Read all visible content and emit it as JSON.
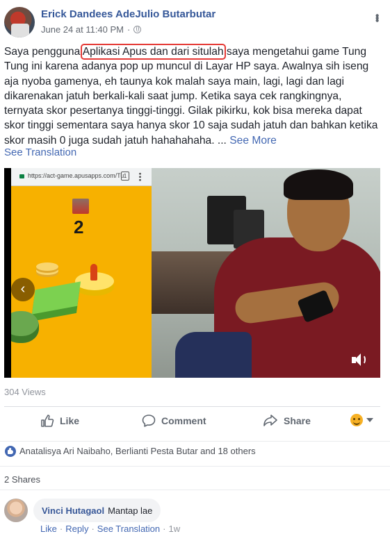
{
  "post": {
    "author": "Erick Dandees AdeJulio Butarbutar",
    "timestamp": "June 24 at 11:40 PM",
    "separator": "·",
    "privacy_icon": "globe-icon",
    "text_before": "Saya pengguna ",
    "text_highlight": "Aplikasi Apus dan dari situlah",
    "text_after": " saya mengetahui game Tung Tung ini karena adanya pop up muncul di Layar HP saya. Awalnya sih iseng aja nyoba gamenya, eh taunya kok malah saya main, lagi, lagi dan lagi dikarenakan jatuh berkali-kali saat jump. Ketika saya cek rangkingnya, ternyata skor pesertanya tinggi-tinggi. Gilak pikirku, kok bisa mereka dapat skor tinggi sementara saya hanya skor 10 saja sudah jatuh dan bahkan ketika skor masih 0 juga sudah jatuh hahahahaha. ...",
    "see_more": "See More",
    "see_translation": "See Translation",
    "highlight_color": "#e53935"
  },
  "video": {
    "url_bar": "https://act-game.apusapps.com/Tu",
    "tab_count": "1",
    "game_score": "2",
    "prev_arrow": "‹",
    "game_bg_color": "#f7b100",
    "views": "304 Views"
  },
  "actions": {
    "like": "Like",
    "comment": "Comment",
    "share": "Share"
  },
  "reactions": {
    "summary": "Anatalisya Ari Naibaho, Berlianti Pesta Butar and 18 others",
    "shares": "2 Shares"
  },
  "comment": {
    "author": "Vinci Hutagaol",
    "text": "Mantap lae",
    "like": "Like",
    "reply": "Reply",
    "see_translation": "See Translation",
    "time": "1w",
    "dot": "·"
  },
  "colors": {
    "link": "#4267b2",
    "author": "#365899",
    "muted": "#90949c"
  }
}
